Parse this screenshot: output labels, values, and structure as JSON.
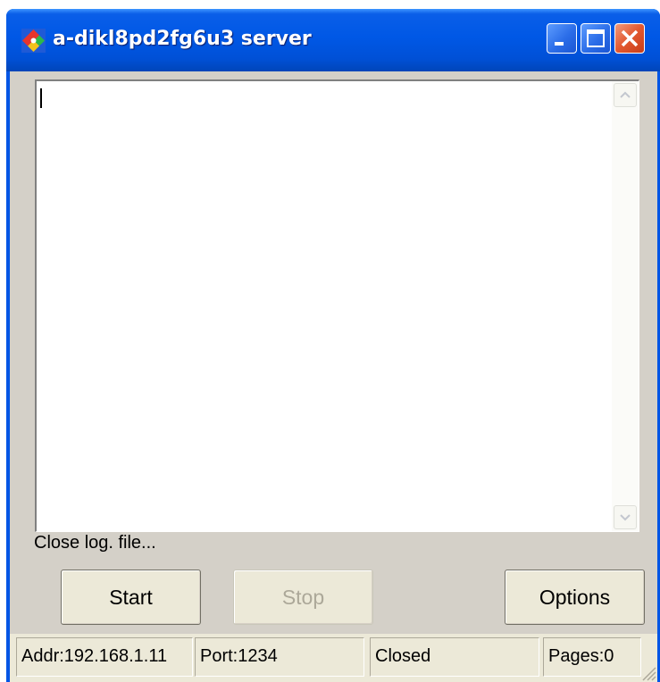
{
  "window": {
    "title": "a-dikl8pd2fg6u3 server",
    "app_icon": "server-app-icon",
    "controls": {
      "minimize": "minimize-icon",
      "maximize": "maximize-icon",
      "close": "close-icon"
    },
    "colors": {
      "titlebar": "#0058e6",
      "close_button": "#e2582f",
      "face": "#d4d0c8"
    }
  },
  "log": {
    "content": ""
  },
  "status_line": "Close log. file...",
  "buttons": {
    "start": "Start",
    "stop": "Stop",
    "options": "Options"
  },
  "statusbar": {
    "addr": "Addr:192.168.1.11",
    "port": "Port:1234",
    "connection": "Closed",
    "pages": "Pages:0"
  }
}
